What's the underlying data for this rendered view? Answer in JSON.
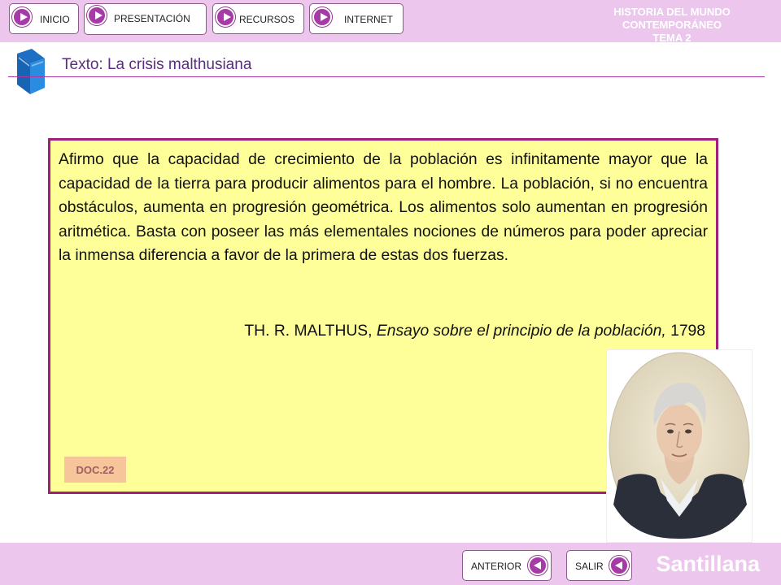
{
  "header": {
    "nav": [
      {
        "label": "INICIO"
      },
      {
        "label": "PRESENTACIÓN"
      },
      {
        "label": "RECURSOS"
      },
      {
        "label": "INTERNET"
      }
    ],
    "course_title": "HISTORIA DEL MUNDO CONTEMPORÁNEO",
    "course_subtitle": "TEMA 2"
  },
  "document": {
    "title": "Texto: La crisis malthusiana",
    "quote": "Afirmo que la capacidad de crecimiento de la población es infinitamente mayor que la capacidad de la tierra para producir alimentos para el hombre. La población, si no encuentra obstáculos, aumenta en progresión geométrica. Los alimentos solo aumentan en progresión aritmética. Basta con poseer las más elementales nociones de números para poder apreciar la inmensa diferencia a favor de la primera de estas dos fuerzas.",
    "author": "TH. R. MALTHUS, ",
    "work": "Ensayo sobre el principio de la población,",
    "year": " 1798",
    "badge": "DOC.22"
  },
  "footer": {
    "prev_label": "ANTERIOR",
    "exit_label": "SALIR",
    "brand": "Santillana"
  },
  "colors": {
    "bar_background": "#ecc6ec",
    "accent": "#a63aa6",
    "title_text": "#5a2d82",
    "quote_background": "#ffff99",
    "quote_border": "#a01f7a",
    "badge_background": "#f7c59a"
  },
  "icons": [
    "play-icon",
    "book-icon",
    "back-arrow-icon"
  ]
}
